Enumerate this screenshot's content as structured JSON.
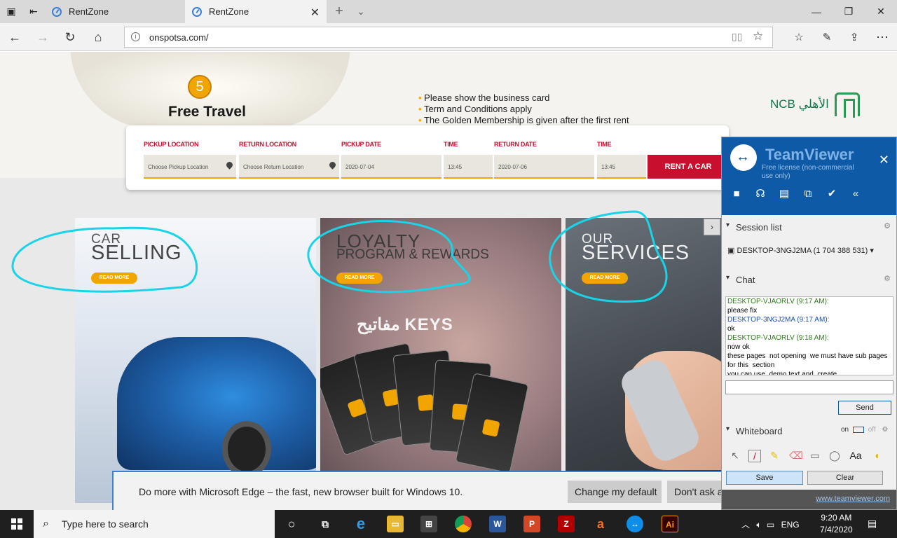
{
  "browser": {
    "tabs": [
      {
        "label": "RentZone"
      },
      {
        "label": "RentZone"
      }
    ],
    "url": "onspotsa.com/"
  },
  "hero": {
    "badge_number": "5",
    "title": "Free Travel",
    "bullets": [
      "Please show the business card",
      "Term and Conditions apply",
      "The Golden Membership is given after the first rent"
    ],
    "ncb_logo_text": "NCB الأهلي"
  },
  "booking": {
    "labels": {
      "pickup_location": "PICKUP LOCATION",
      "return_location": "RETURN LOCATION",
      "pickup_date": "PICKUP DATE",
      "time1": "TIME",
      "return_date": "RETURN DATE",
      "time2": "TIME"
    },
    "values": {
      "pickup_location": "Choose Pickup Location",
      "return_location": "Choose Return Location",
      "pickup_date": "2020-07-04",
      "pickup_time": "13:45",
      "return_date": "2020-07-06",
      "return_time": "13:45"
    },
    "button": "RENT A CAR"
  },
  "panels": [
    {
      "title_small": "CAR",
      "title_big": "SELLING",
      "button": "READ MORE"
    },
    {
      "title_small": "LOYALTY",
      "title_big": "PROGRAM & REWARDS",
      "button": "READ MORE",
      "logo": "مفاتيح KEYS"
    },
    {
      "title_small": "OUR",
      "title_big": "SERVICES",
      "button": "READ MORE"
    }
  ],
  "edge_notice": {
    "text": "Do more with Microsoft Edge – the fast, new browser built for Windows 10.",
    "change_default": "Change my default",
    "dont_ask": "Don't ask again"
  },
  "teamviewer": {
    "title": "TeamViewer",
    "license": "Free license (non-commercial use only)",
    "session_list_label": "Session list",
    "session_entry": "DESKTOP-3NGJ2MA (1 704 388 531)",
    "chat_label": "Chat",
    "chat": [
      {
        "name": "DESKTOP-VJAORLV (9:17 AM):",
        "text": "please fix",
        "kind": "other"
      },
      {
        "name": "DESKTOP-3NGJ2MA (9:17 AM):",
        "text": "ok",
        "kind": "self"
      },
      {
        "name": "DESKTOP-VJAORLV (9:18 AM):",
        "text": "now ok\nthese pages  not opening  we must have sub pages for this  section\nyou can use  demo text and  create",
        "kind": "other"
      }
    ],
    "send": "Send",
    "whiteboard_label": "Whiteboard",
    "wb_on": "on",
    "wb_off": "off",
    "save": "Save",
    "clear": "Clear",
    "footer_url": "www.teamviewer.com"
  },
  "taskbar": {
    "search_placeholder": "Type here to search",
    "language": "ENG",
    "time": "9:20 AM",
    "date": "7/4/2020"
  },
  "colors": {
    "accent_red": "#c8102e",
    "accent_orange": "#f0a500",
    "annotation_cyan": "#19d4e8",
    "teamviewer_blue": "#0e5aa7"
  }
}
